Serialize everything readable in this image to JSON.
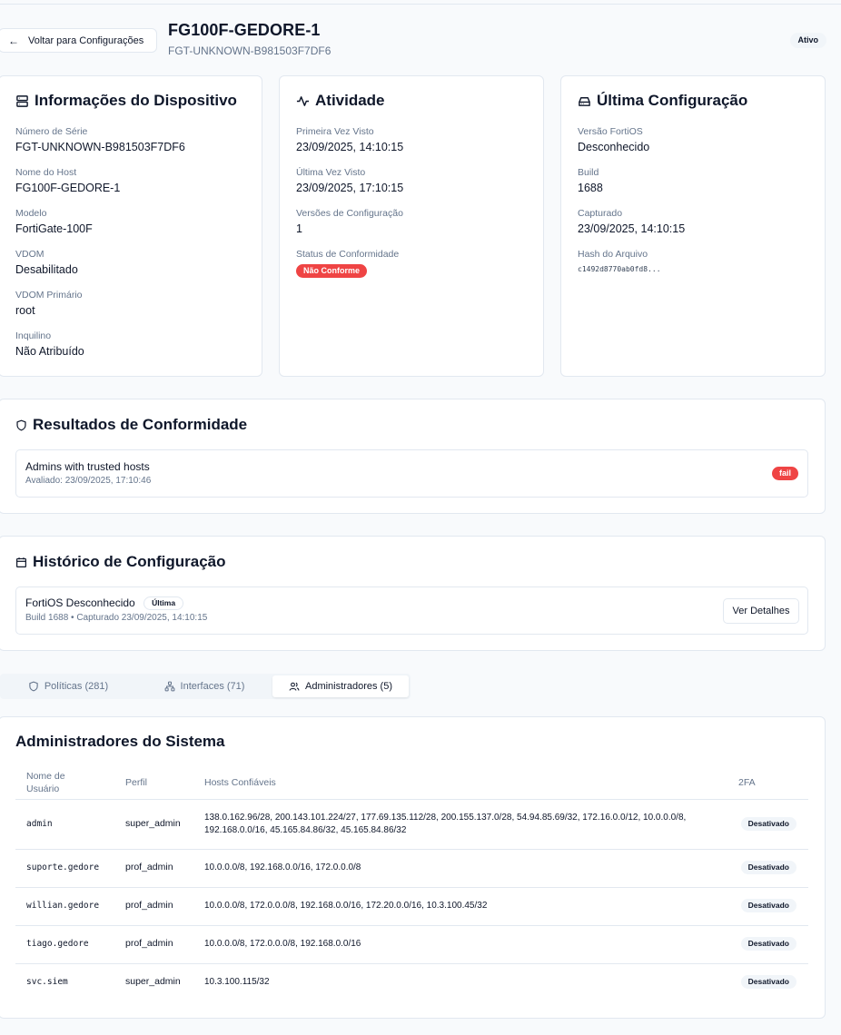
{
  "header": {
    "back_label": "Voltar para Configurações",
    "title": "FG100F-GEDORE-1",
    "subtitle": "FGT-UNKNOWN-B981503F7DF6",
    "status": "Ativo"
  },
  "device_info": {
    "title": "Informações do Dispositivo",
    "icon": "server-icon",
    "fields": [
      {
        "label": "Número de Série",
        "value": "FGT-UNKNOWN-B981503F7DF6"
      },
      {
        "label": "Nome do Host",
        "value": "FG100F-GEDORE-1"
      },
      {
        "label": "Modelo",
        "value": "FortiGate-100F"
      },
      {
        "label": "VDOM",
        "value": "Desabilitado"
      },
      {
        "label": "VDOM Primário",
        "value": "root"
      },
      {
        "label": "Inquilino",
        "value": "Não Atribuído"
      }
    ]
  },
  "activity": {
    "title": "Atividade",
    "icon": "activity-icon",
    "first_seen_label": "Primeira Vez Visto",
    "first_seen": "23/09/2025, 14:10:15",
    "last_seen_label": "Última Vez Visto",
    "last_seen": "23/09/2025, 17:10:15",
    "versions_label": "Versões de Configuração",
    "versions": "1",
    "compliance_label": "Status de Conformidade",
    "compliance_badge": "Não Conforme"
  },
  "last_config": {
    "title": "Última Configuração",
    "icon": "hard-drive-icon",
    "fortios_label": "Versão FortiOS",
    "fortios": "Desconhecido",
    "build_label": "Build",
    "build": "1688",
    "captured_label": "Capturado",
    "captured": "23/09/2025, 14:10:15",
    "hash_label": "Hash do Arquivo",
    "hash": "c1492d8770ab0fd8..."
  },
  "compliance": {
    "title": "Resultados de Conformidade",
    "icon": "shield-icon",
    "item_title": "Admins with trusted hosts",
    "item_sub": "Avaliado: 23/09/2025, 17:10:46",
    "item_status": "fail"
  },
  "history": {
    "title": "Histórico de Configuração",
    "icon": "calendar-icon",
    "item_title": "FortiOS Desconhecido",
    "item_badge": "Última",
    "item_sub": "Build 1688 • Capturado 23/09/2025, 14:10:15",
    "button": "Ver Detalhes"
  },
  "tabs": [
    {
      "label": "Políticas (281)",
      "icon": "shield-icon",
      "active": false
    },
    {
      "label": "Interfaces (71)",
      "icon": "network-icon",
      "active": false
    },
    {
      "label": "Administradores (5)",
      "icon": "users-icon",
      "active": true
    }
  ],
  "admins": {
    "title": "Administradores do Sistema",
    "columns": [
      "Nome de Usuário",
      "Perfil",
      "Hosts Confiáveis",
      "2FA"
    ],
    "rows": [
      {
        "user": "admin",
        "profile": "super_admin",
        "hosts": "138.0.162.96/28, 200.143.101.224/27, 177.69.135.112/28, 200.155.137.0/28, 54.94.85.69/32, 172.16.0.0/12, 10.0.0.0/8, 192.168.0.0/16, 45.165.84.86/32, 45.165.84.86/32",
        "twofa": "Desativado"
      },
      {
        "user": "suporte.gedore",
        "profile": "prof_admin",
        "hosts": "10.0.0.0/8, 192.168.0.0/16, 172.0.0.0/8",
        "twofa": "Desativado"
      },
      {
        "user": "willian.gedore",
        "profile": "prof_admin",
        "hosts": "10.0.0.0/8, 172.0.0.0/8, 192.168.0.0/16, 172.20.0.0/16, 10.3.100.45/32",
        "twofa": "Desativado"
      },
      {
        "user": "tiago.gedore",
        "profile": "prof_admin",
        "hosts": "10.0.0.0/8, 172.0.0.0/8, 192.168.0.0/16",
        "twofa": "Desativado"
      },
      {
        "user": "svc.siem",
        "profile": "super_admin",
        "hosts": "10.3.100.115/32",
        "twofa": "Desativado"
      }
    ]
  }
}
